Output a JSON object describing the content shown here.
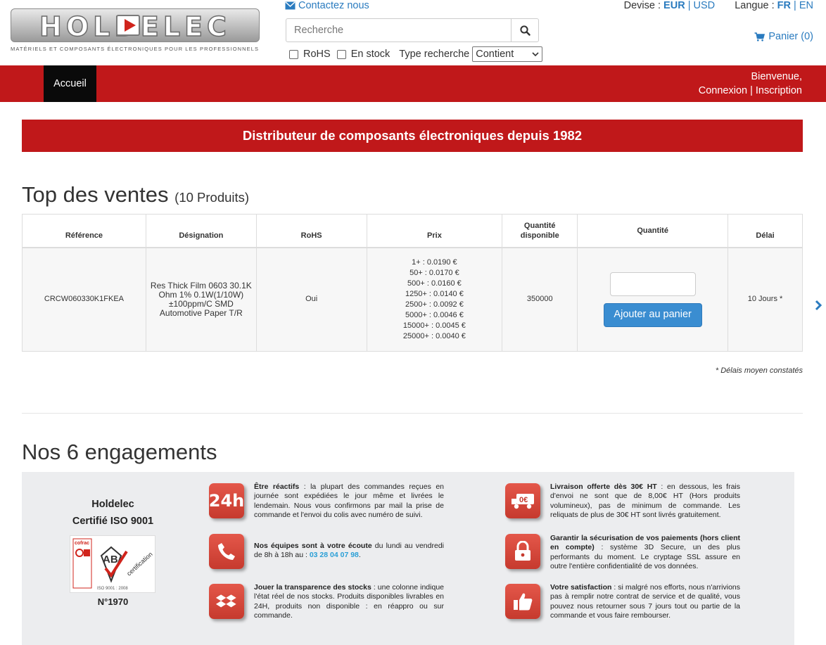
{
  "logo": {
    "word": "HOLDELEC",
    "tagline": "MATÉRIELS ET COMPOSANTS ÉLECTRONIQUES POUR LES PROFESSIONNELS"
  },
  "header": {
    "contact_label": "Contactez nous",
    "search_placeholder": "Recherche",
    "filter_rohs": "RoHS",
    "filter_stock": "En stock",
    "search_type_label": "Type recherche",
    "search_type_value": "Contient",
    "currency_label": "Devise :",
    "currency_eur": "EUR",
    "currency_usd": "USD",
    "language_label": "Langue :",
    "lang_fr": "FR",
    "lang_en": "EN",
    "cart_label": "Panier (0)"
  },
  "nav": {
    "home": "Accueil",
    "welcome": "Bienvenue,",
    "login": "Connexion",
    "register": "Inscription"
  },
  "banner": "Distributeur de composants électroniques depuis 1982",
  "top_sales": {
    "title": "Top des ventes",
    "count": "(10 Produits)",
    "columns": {
      "reference": "Référence",
      "designation": "Désignation",
      "rohs": "RoHS",
      "price": "Prix",
      "qty_available_1": "Quantité",
      "qty_available_2": "disponible",
      "quantity": "Quantité",
      "delay": "Délai"
    },
    "row": {
      "reference": "CRCW060330K1FKEA",
      "designation": "Res Thick Film 0603 30.1K Ohm 1% 0.1W(1/10W) ±100ppm/C SMD Automotive Paper T/R",
      "rohs": "Oui",
      "prices": [
        "1+ : 0.0190 €",
        "50+ : 0.0170 €",
        "500+ : 0.0160 €",
        "1250+ : 0.0140 €",
        "2500+ : 0.0092 €",
        "5000+ : 0.0046 €",
        "15000+ : 0.0045 €",
        "25000+ : 0.0040 €"
      ],
      "available": "350000",
      "add_button": "Ajouter au panier",
      "delay": "10 Jours *"
    },
    "note": "* Délais moyen constatés"
  },
  "engagements": {
    "title": "Nos 6 engagements",
    "cert_line1": "Holdelec",
    "cert_line2": "Certifié ISO 9001",
    "cert_number": "N°1970",
    "items": [
      {
        "icon": "24h-icon",
        "bold": "Être réactifs",
        "text": " : la plupart des commandes reçues en journée sont expédiées le jour même et livrées le lendemain. Nous vous confirmons par mail la prise de commande et l'envoi du colis avec numéro de suivi."
      },
      {
        "icon": "phone-icon",
        "bold": "Nos équipes sont à votre écoute",
        "text": " du lundi au vendredi de 8h à 18h au : ",
        "phone": "03 28 04 07 98",
        "tail": "."
      },
      {
        "icon": "box-icon",
        "bold": "Jouer la transparence des stocks",
        "text": " : une colonne indique l'état réel de nos stocks. Produits disponibles livrables en 24H, produits non disponible : en réappro ou sur commande."
      },
      {
        "icon": "truck-icon",
        "bold": "Livraison offerte dès 30€ HT",
        "text": " : en dessous, les frais d'envoi ne sont que de 8,00€ HT (Hors produits volumineux), pas de minimum de commande. Les reliquats de plus de 30€ HT sont livrés gratuitement."
      },
      {
        "icon": "lock-icon",
        "bold": "Garantir la sécurisation de vos paiements (hors client en compte)",
        "text": " : système 3D Secure, un des plus performants du moment. Le cryptage SSL assure en outre l'entière confidentialité de vos données."
      },
      {
        "icon": "thumbs-up-icon",
        "bold": "Votre satisfaction",
        "text": " : si malgré nos efforts, nous n'arrivions pas à remplir notre contrat de service et de qualité, vous pouvez nous retourner sous 7 jours tout ou partie de la commande et vous faire rembourser."
      }
    ]
  }
}
